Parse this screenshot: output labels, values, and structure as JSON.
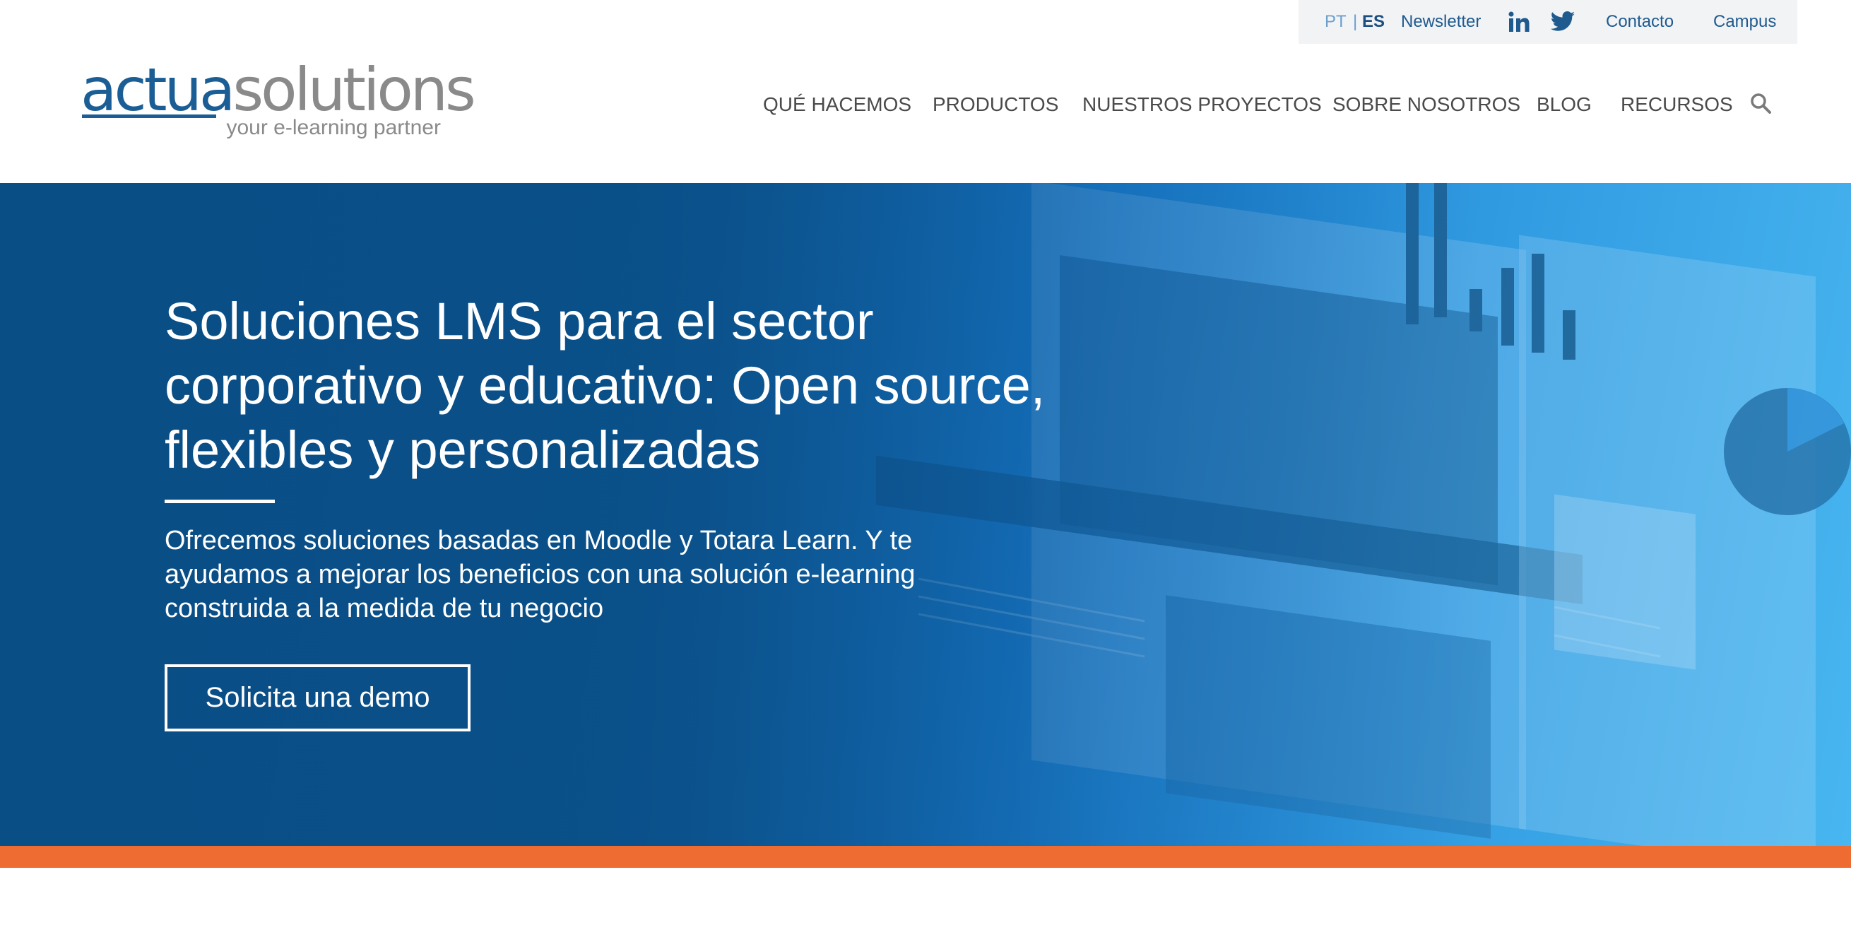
{
  "utility_bar": {
    "lang_pt": "PT",
    "lang_separator": "|",
    "lang_es": "ES",
    "newsletter": "Newsletter",
    "linkedin_icon": "linkedin-icon",
    "twitter_icon": "twitter-icon",
    "contacto": "Contacto",
    "campus": "Campus"
  },
  "logo": {
    "part1": "actua",
    "part2": "solutions",
    "tagline": "your e-learning partner"
  },
  "nav": {
    "items": [
      "QUÉ HACEMOS",
      "PRODUCTOS",
      "NUESTROS PROYECTOS",
      "SOBRE NOSOTROS",
      "BLOG",
      "RECURSOS"
    ],
    "search_icon": "search-icon"
  },
  "hero": {
    "title": "Soluciones LMS para el sector corporativo y educativo: Open source, flexibles y personalizadas",
    "subtitle": "Ofrecemos soluciones basadas en Moodle y Totara Learn. Y te ayudamos a mejorar los beneficios con una solución e-learning construida a la medida de tu negocio",
    "cta": "Solicita una demo"
  },
  "colors": {
    "brand_blue": "#1b5e96",
    "hero_blue": "#0a4e86",
    "accent_orange": "#ee6b31",
    "gray": "#8a8a8a"
  }
}
